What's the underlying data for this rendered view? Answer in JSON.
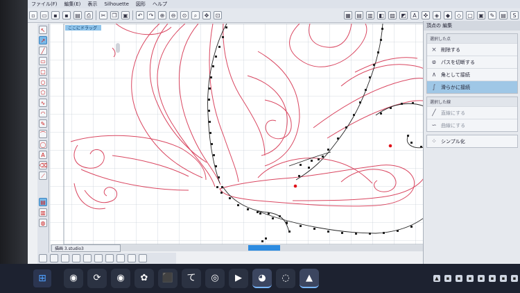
{
  "menubar": {
    "items": [
      "ファイル(F)",
      "編集(E)",
      "表示",
      "Silhouette",
      "図形",
      "ヘルプ"
    ]
  },
  "toolbar": {
    "left_icons": [
      "new-icon",
      "open-icon",
      "save-icon",
      "save-as-icon",
      "library-icon",
      "print-icon",
      "cut-icon",
      "copy-icon",
      "paste-icon",
      "undo-icon",
      "redo-icon",
      "zoom-in-icon",
      "zoom-out-icon",
      "zoom-fit-icon",
      "zoom-select-icon",
      "pan-icon",
      "zoom-page-icon"
    ],
    "right_icons": [
      "grid-icon",
      "page-setup-icon",
      "registration-icon",
      "fill-icon",
      "line-icon",
      "color-icon",
      "text-style-icon",
      "transform-icon",
      "replicate-icon",
      "align-icon",
      "offset-icon",
      "trace-icon",
      "modify-icon",
      "knife-icon",
      "library-view-icon",
      "send-icon"
    ]
  },
  "canvas": {
    "label": "ここにドラッグ"
  },
  "doc_tab": {
    "label": "描画 3.studio3"
  },
  "panel": {
    "title": "頂点の 編集",
    "section1_label": "選択した点",
    "items": [
      {
        "icon": "×",
        "label": "削除する"
      },
      {
        "icon": "ⱷ",
        "label": "パスを切断する"
      },
      {
        "icon": "∧",
        "label": "角として接続"
      },
      {
        "icon": "∫",
        "label": "滑らかに接続"
      }
    ],
    "section2_label": "選択した線",
    "items2": [
      {
        "icon": "╱",
        "label": "直線にする"
      },
      {
        "icon": "∽",
        "label": "曲線にする"
      }
    ],
    "simplify_label": "シンプル化"
  },
  "taskbar": {
    "apps": [
      "◉",
      "⟳",
      "◉",
      "✿",
      "⬛",
      "て",
      "◎",
      "▶",
      "◕",
      "◌",
      "▲"
    ]
  },
  "colors": {
    "curve": "#d9455f",
    "points": "#222222",
    "selected_point": "#e0121a",
    "accent": "#2d8be0"
  }
}
